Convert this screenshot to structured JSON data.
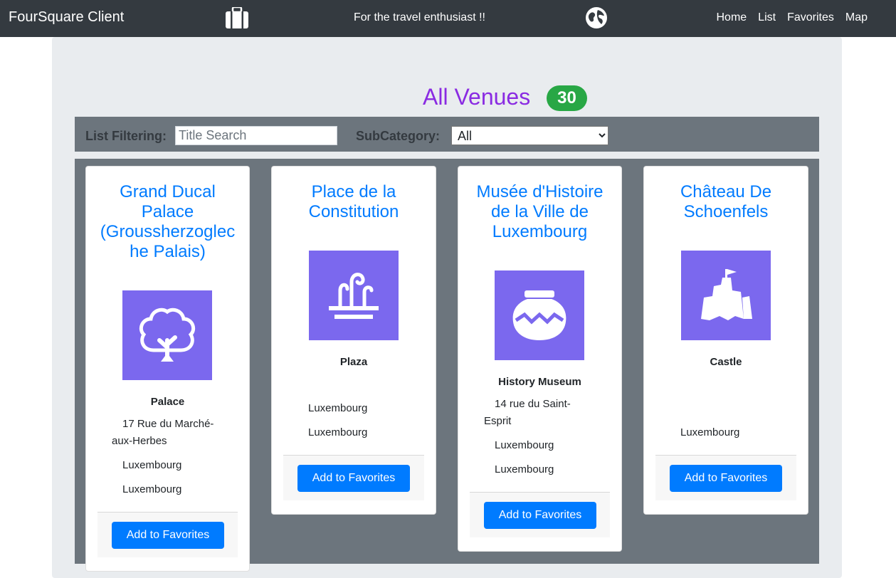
{
  "navbar": {
    "brand": "FourSquare Client",
    "tagline": "For the travel enthusiast !!",
    "links": [
      "Home",
      "List",
      "Favorites",
      "Map"
    ]
  },
  "page": {
    "heading": "All Venues",
    "count": "30"
  },
  "filters": {
    "label": "List Filtering:",
    "title_placeholder": "Title Search",
    "title_value": "",
    "subcategory_label": "SubCategory:",
    "subcategory_selected": "All"
  },
  "venues": [
    {
      "title": "Grand Ducal Palace (Groussherzoglec he Palais)",
      "icon": "tree-icon",
      "category": "Palace",
      "address": "17 Rue du Marché-aux-Herbes",
      "city": "Luxembourg",
      "country": "Luxembourg",
      "button": "Add to Favorites"
    },
    {
      "title": "Place de la Constitution",
      "icon": "fountain-icon",
      "category": "Plaza",
      "address": "",
      "city": "Luxembourg",
      "country": "Luxembourg",
      "button": "Add to Favorites"
    },
    {
      "title": "Musée d'Histoire de la Ville de Luxembourg",
      "icon": "vase-icon",
      "category": "History Museum",
      "address": "14 rue du Saint-Esprit",
      "city": "Luxembourg",
      "country": "Luxembourg",
      "button": "Add to Favorites"
    },
    {
      "title": "Château De Schoenfels",
      "icon": "castle-icon",
      "category": "Castle",
      "address": "",
      "city": "",
      "country": "Luxembourg",
      "button": "Add to Favorites"
    }
  ],
  "colors": {
    "navbar": "#343a40",
    "heading": "#8a2be2",
    "badge": "#28a745",
    "link": "#007bff",
    "icon_bg": "#7b68ee",
    "panel": "#6c757d"
  }
}
